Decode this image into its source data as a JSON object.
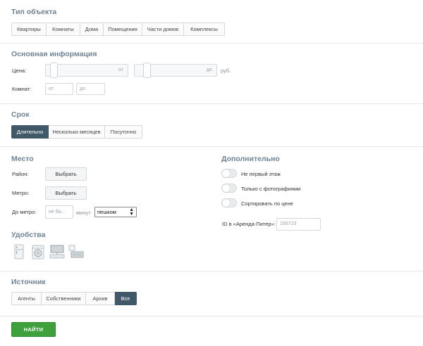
{
  "object_type": {
    "title": "Тип объекта",
    "options": [
      "Квартиры",
      "Комнаты",
      "Дома",
      "Помещения",
      "Части домов",
      "Комплексы"
    ]
  },
  "basic_info": {
    "title": "Основная информация",
    "price_label": "Цена:",
    "price_from_placeholder": "от",
    "price_to_placeholder": "до",
    "currency": "руб.",
    "rooms_label": "Комнат:",
    "rooms_from_placeholder": "от",
    "rooms_to_placeholder": "до"
  },
  "term": {
    "title": "Срок",
    "options": [
      "Длительно",
      "Несколько месяцев",
      "Посуточно"
    ],
    "active_index": 0
  },
  "place": {
    "title": "Место",
    "district_label": "Район:",
    "district_button": "Выбрать",
    "metro_label": "Метро:",
    "metro_button": "Выбрать",
    "to_metro_label": "До метро:",
    "to_metro_placeholder": "не бо...",
    "minutes_label": "минут",
    "transport_value": "пешком"
  },
  "additional": {
    "title": "Дополнительно",
    "toggles": [
      "Не первый этаж",
      "Только с фотографиями",
      "Сортировать по цене"
    ],
    "id_label": "ID в «Аренда-Питер»:",
    "id_placeholder": "156723"
  },
  "amenities": {
    "title": "Удобства",
    "icons": [
      "fridge-icon",
      "washing-machine-icon",
      "tv-furniture-icon",
      "furniture-icon"
    ]
  },
  "source": {
    "title": "Источник",
    "options": [
      "Агенты",
      "Собственники",
      "Архив",
      "Все"
    ],
    "active_index": 3
  },
  "submit": {
    "label": "НАЙТИ"
  },
  "colors": {
    "accent": "#415868",
    "submit": "#3ea13c",
    "title": "#6e8394"
  }
}
